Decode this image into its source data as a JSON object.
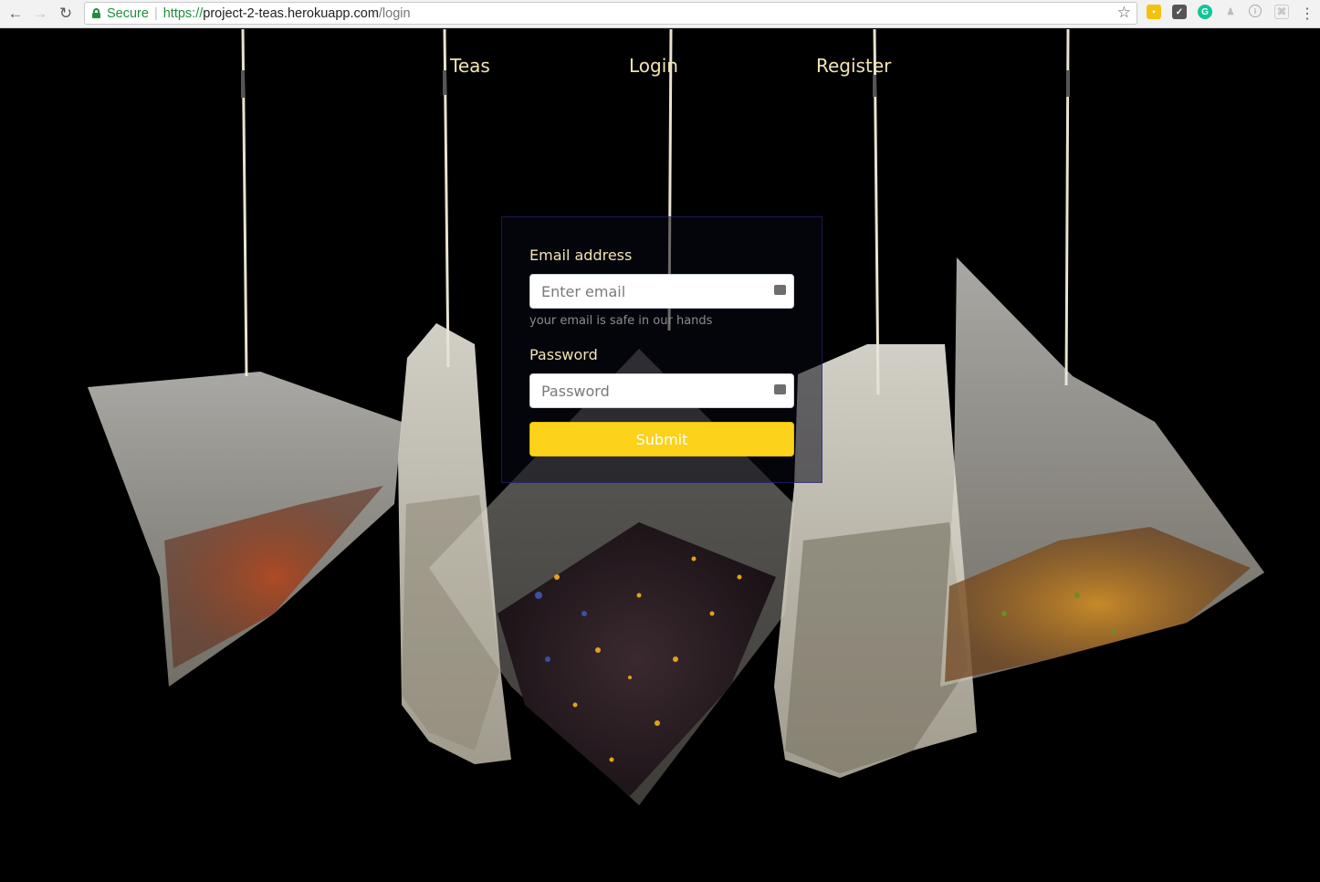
{
  "browser": {
    "secure_label": "Secure",
    "url_scheme": "https://",
    "url_host": "project-2-teas.herokuapp.com",
    "url_path": "/login"
  },
  "nav": {
    "teas": "Teas",
    "login": "Login",
    "register": "Register"
  },
  "form": {
    "email_label": "Email address",
    "email_placeholder": "Enter email",
    "email_help": "your email is safe in our hands",
    "password_label": "Password",
    "password_placeholder": "Password",
    "submit_label": "Submit"
  },
  "colors": {
    "nav_text": "#f3e3b5",
    "submit_bg": "#fcd21b",
    "secure_green": "#1e8e3e"
  }
}
